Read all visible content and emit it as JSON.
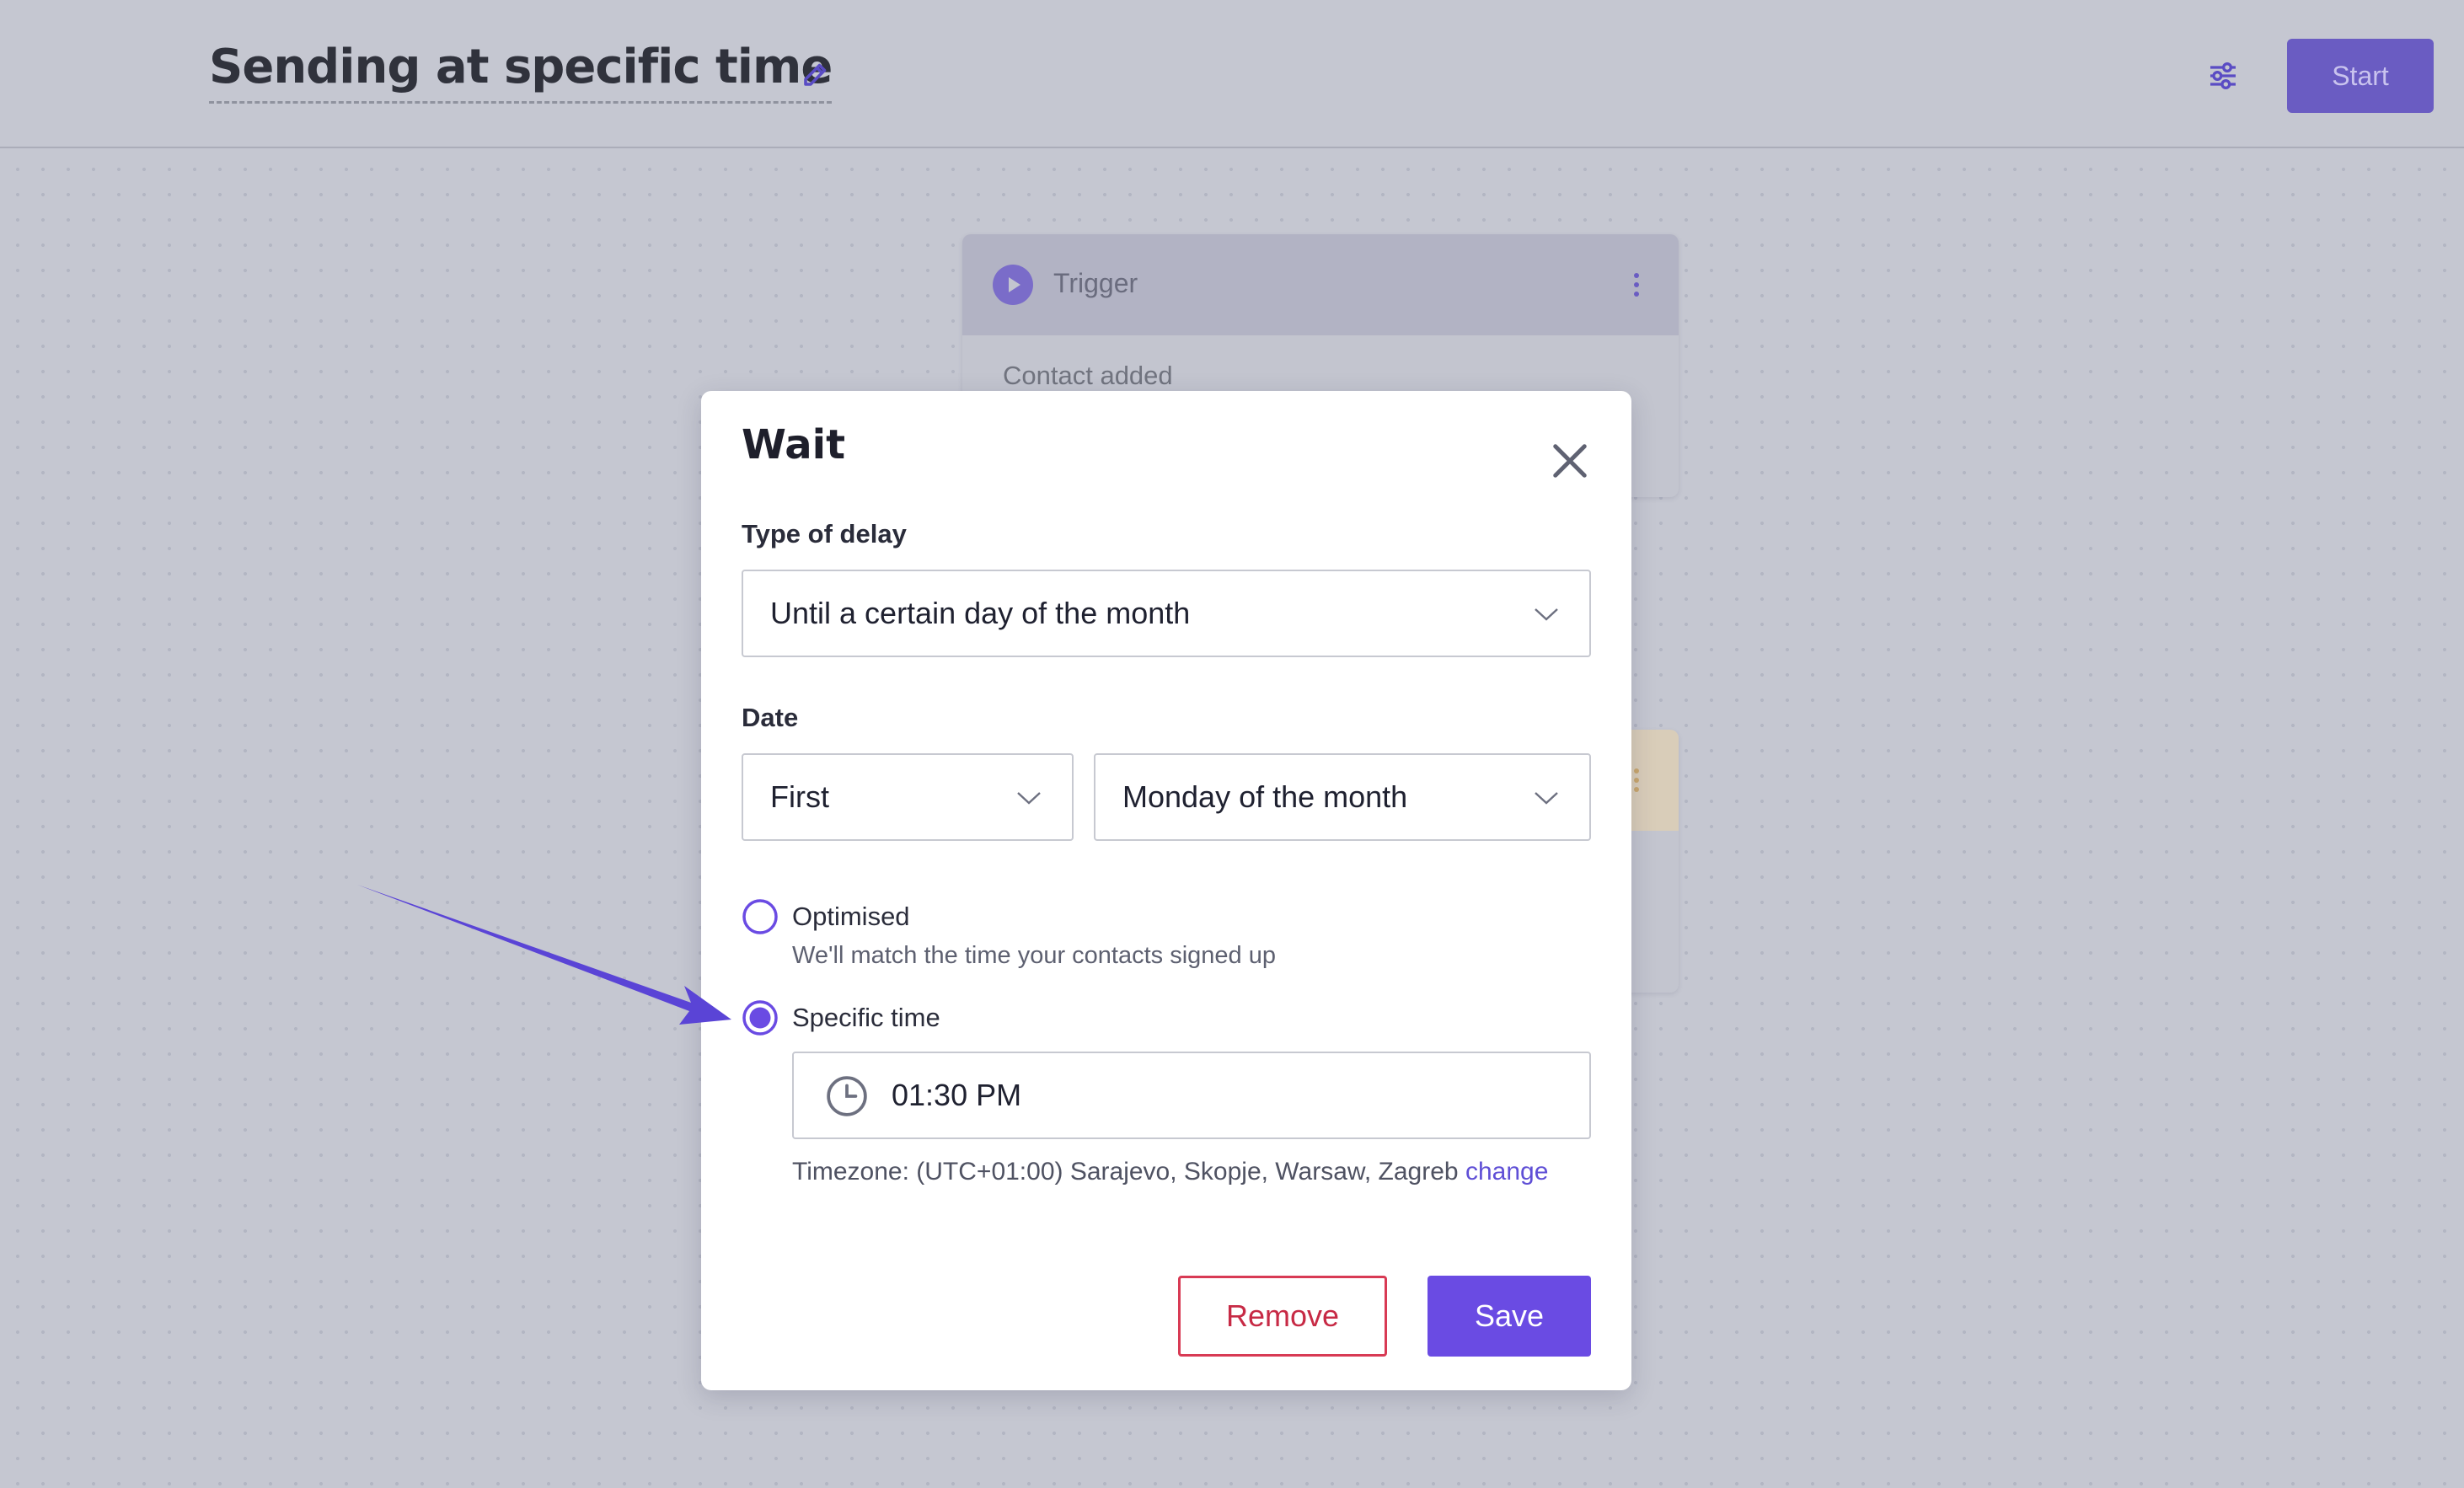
{
  "header": {
    "title": "Sending at specific time",
    "start_label": "Start",
    "edit_icon": "edit-icon",
    "settings_icon": "sliders-icon"
  },
  "canvas": {
    "trigger_card": {
      "title": "Trigger",
      "subtitle": "Contact added",
      "icon": "play-icon"
    }
  },
  "modal": {
    "title": "Wait",
    "type_of_delay": {
      "label": "Type of delay",
      "value": "Until a certain day of the month"
    },
    "date": {
      "label": "Date",
      "ordinal_value": "First",
      "day_value": "Monday of the month"
    },
    "timing": {
      "selected": "specific",
      "optimised_label": "Optimised",
      "optimised_hint": "We'll match the time your contacts signed up",
      "specific_label": "Specific time",
      "time_value": "01:30 PM"
    },
    "timezone": {
      "text": "Timezone: (UTC+01:00) Sarajevo, Skopje, Warsaw, Zagreb",
      "change_label": "change"
    },
    "remove_label": "Remove",
    "save_label": "Save"
  },
  "colors": {
    "accent": "#6a4be3",
    "danger": "#c72a45",
    "overlay_bg": "#c5c7d1"
  }
}
